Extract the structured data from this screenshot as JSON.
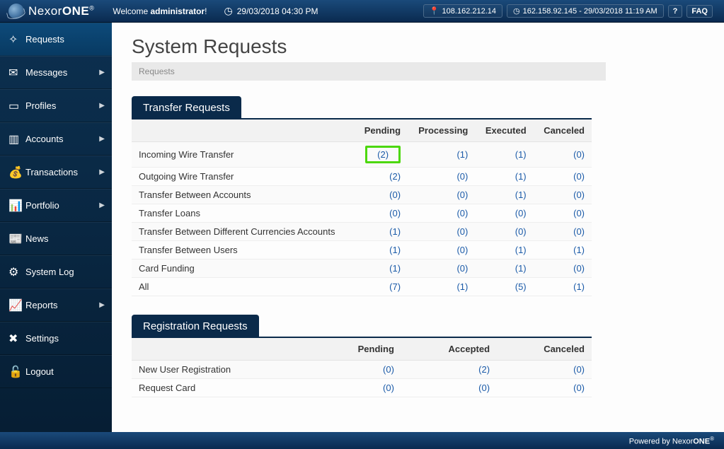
{
  "brand": {
    "name_light": "Nexor",
    "name_bold": "ONE",
    "reg": "®"
  },
  "header": {
    "welcome_prefix": "Welcome ",
    "welcome_user": "administrator",
    "welcome_suffix": "!",
    "datetime": "29/03/2018 04:30 PM",
    "ip_current": "108.162.212.14",
    "ip_session": "162.158.92.145 - 29/03/2018 11:19 AM",
    "help_label": "?",
    "faq_label": "FAQ"
  },
  "sidebar": {
    "items": [
      {
        "label": "Requests",
        "icon": "✧",
        "expandable": false,
        "active": true
      },
      {
        "label": "Messages",
        "icon": "✉",
        "expandable": true,
        "active": false
      },
      {
        "label": "Profiles",
        "icon": "▭",
        "expandable": true,
        "active": false
      },
      {
        "label": "Accounts",
        "icon": "▥",
        "expandable": true,
        "active": false
      },
      {
        "label": "Transactions",
        "icon": "💰",
        "expandable": true,
        "active": false
      },
      {
        "label": "Portfolio",
        "icon": "📊",
        "expandable": true,
        "active": false
      },
      {
        "label": "News",
        "icon": "📰",
        "expandable": false,
        "active": false
      },
      {
        "label": "System Log",
        "icon": "⚙",
        "expandable": false,
        "active": false
      },
      {
        "label": "Reports",
        "icon": "📈",
        "expandable": true,
        "active": false
      },
      {
        "label": "Settings",
        "icon": "✖",
        "expandable": false,
        "active": false
      },
      {
        "label": "Logout",
        "icon": "🔓",
        "expandable": false,
        "active": false
      }
    ],
    "chevron": "▶"
  },
  "page": {
    "title": "System Requests",
    "breadcrumb": "Requests"
  },
  "transfer_panel": {
    "title": "Transfer Requests",
    "columns": [
      "",
      "Pending",
      "Processing",
      "Executed",
      "Canceled"
    ],
    "rows": [
      {
        "label": "Incoming Wire Transfer",
        "cells": [
          "(2)",
          "(1)",
          "(1)",
          "(0)"
        ],
        "highlight_col": 0
      },
      {
        "label": "Outgoing Wire Transfer",
        "cells": [
          "(2)",
          "(0)",
          "(1)",
          "(0)"
        ]
      },
      {
        "label": "Transfer Between Accounts",
        "cells": [
          "(0)",
          "(0)",
          "(1)",
          "(0)"
        ]
      },
      {
        "label": "Transfer Loans",
        "cells": [
          "(0)",
          "(0)",
          "(0)",
          "(0)"
        ]
      },
      {
        "label": "Transfer Between Different Currencies Accounts",
        "cells": [
          "(1)",
          "(0)",
          "(0)",
          "(0)"
        ]
      },
      {
        "label": "Transfer Between Users",
        "cells": [
          "(1)",
          "(0)",
          "(1)",
          "(1)"
        ]
      },
      {
        "label": "Card Funding",
        "cells": [
          "(1)",
          "(0)",
          "(1)",
          "(0)"
        ]
      },
      {
        "label": "All",
        "cells": [
          "(7)",
          "(1)",
          "(5)",
          "(1)"
        ],
        "all": true
      }
    ]
  },
  "registration_panel": {
    "title": "Registration Requests",
    "columns": [
      "",
      "Pending",
      "Accepted",
      "Canceled"
    ],
    "rows": [
      {
        "label": "New User Registration",
        "cells": [
          "(0)",
          "(2)",
          "(0)"
        ]
      },
      {
        "label": "Request Card",
        "cells": [
          "(0)",
          "(0)",
          "(0)"
        ]
      }
    ]
  },
  "footer": {
    "text_prefix": "Powered by ",
    "brand_light": "Nexor",
    "brand_bold": "ONE",
    "reg": "®"
  }
}
